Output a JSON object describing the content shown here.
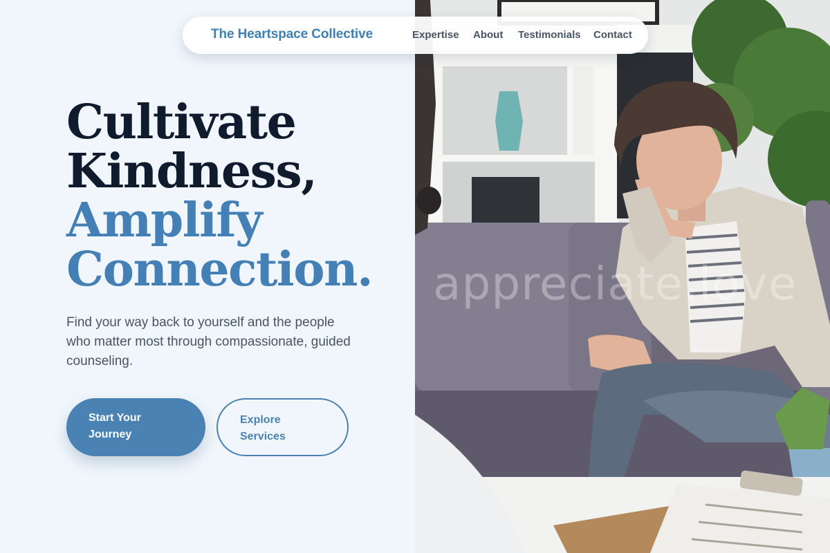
{
  "nav": {
    "brand": "The Heartspace Collective",
    "links": [
      "Expertise",
      "About",
      "Testimonials",
      "Contact"
    ]
  },
  "hero": {
    "title_line1": "Cultivate",
    "title_line2": "Kindness,",
    "title_line3": "Amplify",
    "title_line4": "Connection.",
    "subtitle": "Find your way back to yourself and the people who matter most through compassionate, guided counseling.",
    "primary_button": "Start Your Journey",
    "secondary_button": "Explore Services"
  },
  "photo": {
    "watermark": "appreciate.love"
  },
  "colors": {
    "accent": "#4a82b3",
    "heading_dark": "#101b2d",
    "background": "#f0f6fc"
  }
}
